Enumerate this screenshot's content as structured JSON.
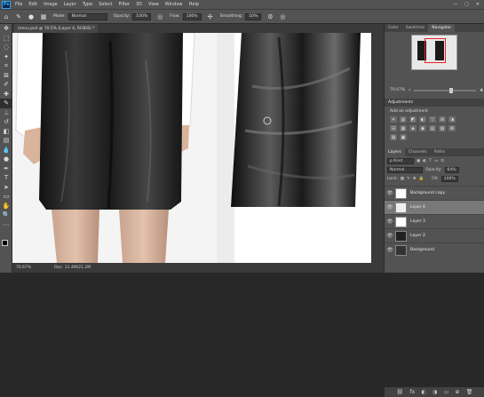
{
  "app": {
    "logo": "Ps",
    "accent": "#31a8ff"
  },
  "menu": [
    "File",
    "Edit",
    "Image",
    "Layer",
    "Type",
    "Select",
    "Filter",
    "3D",
    "View",
    "Window",
    "Help"
  ],
  "window_controls": [
    "—",
    "▢",
    "✕"
  ],
  "options": {
    "mode_label": "Mode:",
    "mode_value": "Normal",
    "opacity_label": "Opacity:",
    "opacity_value": "100%",
    "flow_label": "Flow:",
    "flow_value": "100%",
    "smoothing_label": "Smoothing:",
    "smoothing_value": "10%"
  },
  "doc_tab": "menu.psd @ 70.5% (Layer 4, RGB/8) *",
  "status": {
    "zoom": "70.67%",
    "doc": "Doc: 11.4M/21.2M"
  },
  "panels": {
    "nav_tabs": [
      "Color",
      "Swatches",
      "Navigator"
    ],
    "nav_active": 2,
    "nav_zoom": "70.67%",
    "adj_title": "Adjustments",
    "adj_sub": "Add an adjustment",
    "adj_icons": [
      "☀",
      "▥",
      "◩",
      "◐",
      "▽",
      "⊞",
      "◑",
      "⊟",
      "▦",
      "◈",
      "◉",
      "▤",
      "▧",
      "⊠",
      "▨",
      "▣"
    ]
  },
  "layers": {
    "tabs": [
      "Layers",
      "Channels",
      "Paths"
    ],
    "kind_label": "ρ Kind",
    "blend": "Normal",
    "opacity_label": "Opacity:",
    "opacity_value": "64%",
    "lock_label": "Lock:",
    "fill_label": "Fill:",
    "fill_value": "100%",
    "items": [
      {
        "name": "Background copy",
        "selected": false
      },
      {
        "name": "Layer 4",
        "selected": true
      },
      {
        "name": "Layer 3",
        "selected": false
      },
      {
        "name": "Layer 2",
        "selected": false
      },
      {
        "name": "Background",
        "selected": false
      }
    ],
    "bottom_icons": [
      "⛓",
      "fx",
      "◐",
      "◑",
      "▭",
      "⊕",
      "🗑"
    ]
  }
}
